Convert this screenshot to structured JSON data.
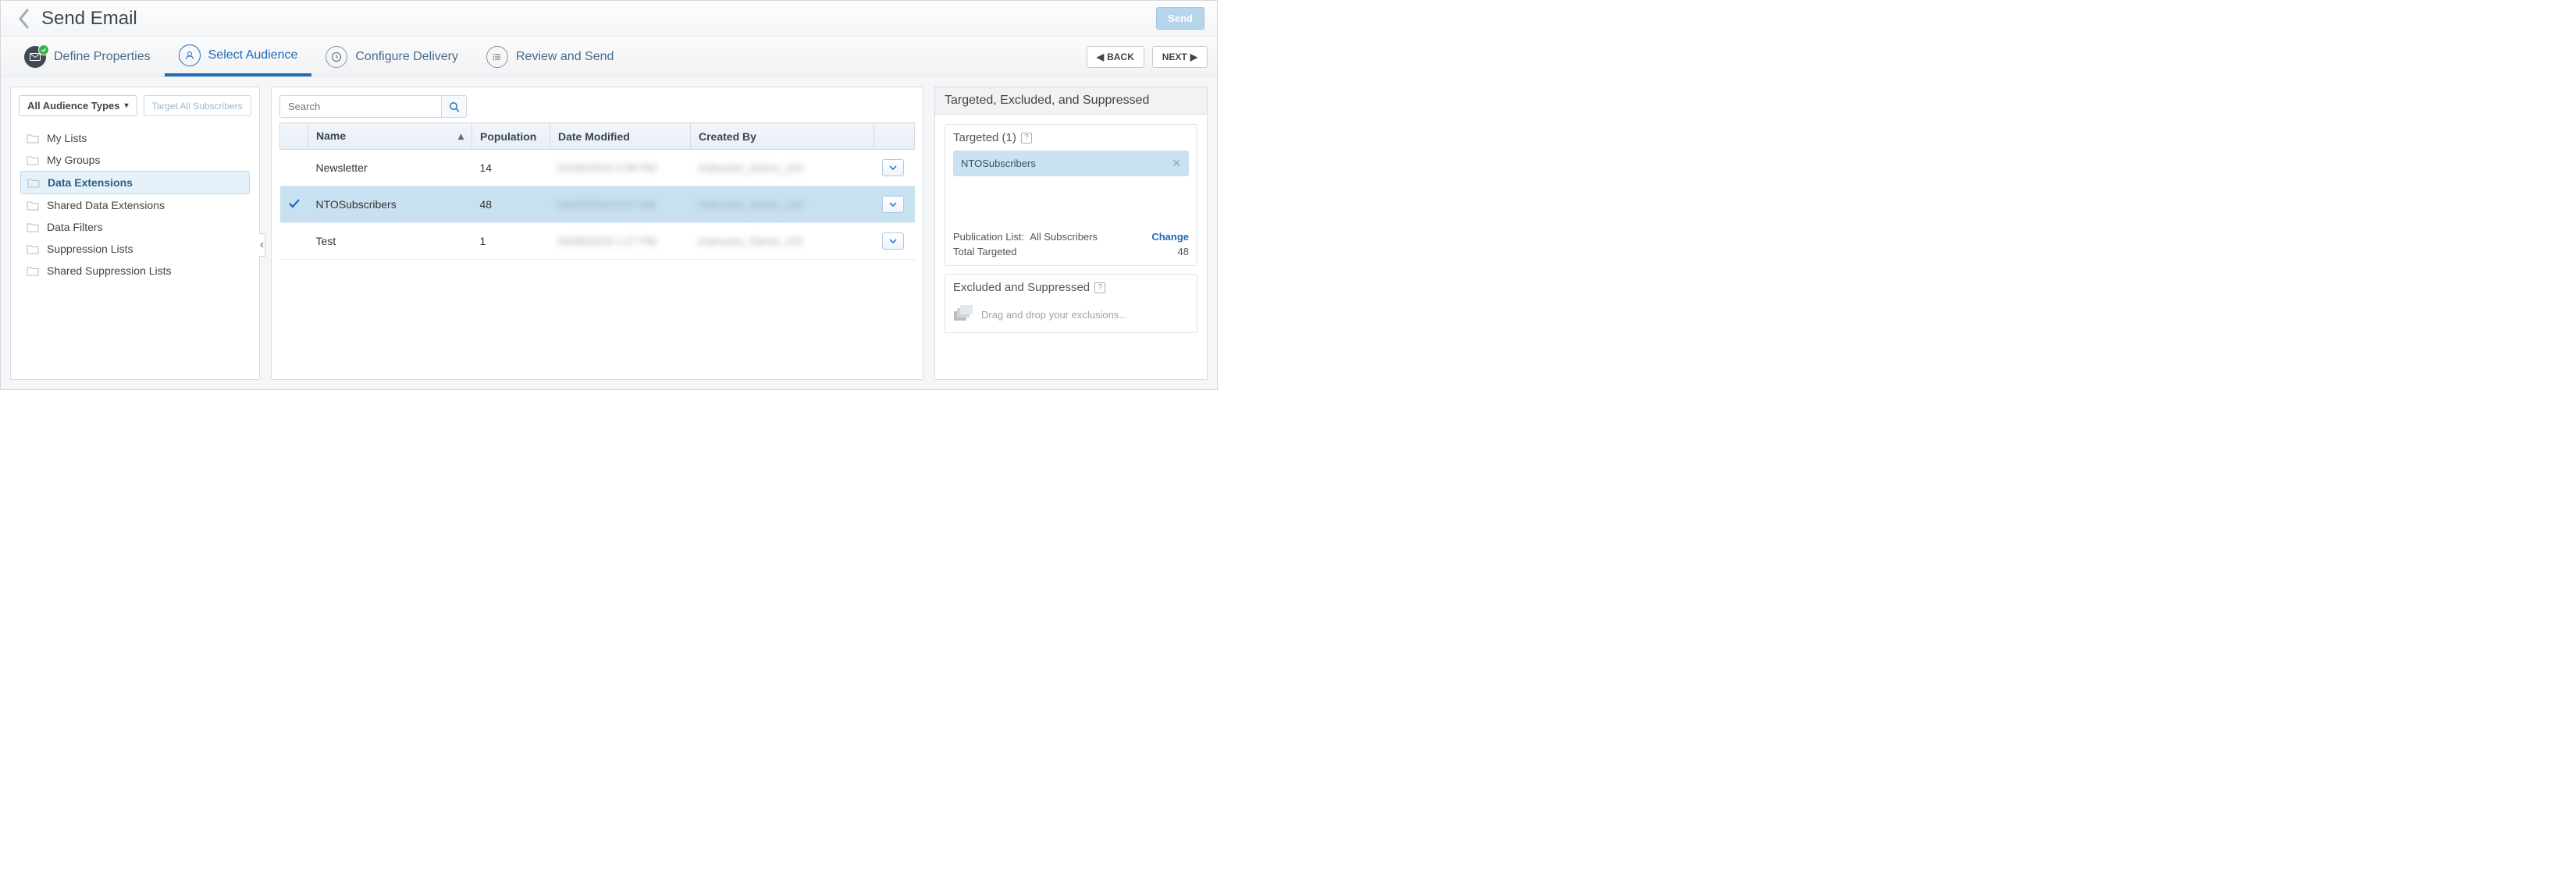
{
  "header": {
    "title": "Send Email",
    "send_label": "Send"
  },
  "wizard": {
    "steps": [
      {
        "label": "Define Properties",
        "icon": "envelope"
      },
      {
        "label": "Select Audience",
        "icon": "user"
      },
      {
        "label": "Configure Delivery",
        "icon": "clock"
      },
      {
        "label": "Review and Send",
        "icon": "list"
      }
    ],
    "back_label": "BACK",
    "next_label": "NEXT"
  },
  "sidebar": {
    "dropdown_label": "All Audience Types",
    "target_all_label": "Target All Subscribers",
    "items": [
      {
        "label": "My Lists"
      },
      {
        "label": "My Groups"
      },
      {
        "label": "Data Extensions"
      },
      {
        "label": "Shared Data Extensions"
      },
      {
        "label": "Data Filters"
      },
      {
        "label": "Suppression Lists"
      },
      {
        "label": "Shared Suppression Lists"
      }
    ]
  },
  "table": {
    "search_placeholder": "Search",
    "columns": {
      "name": "Name",
      "population": "Population",
      "date_modified": "Date Modified",
      "created_by": "Created By"
    },
    "rows": [
      {
        "name": "Newsletter",
        "population": "14",
        "date_mod": "02/26/2019 3:06 PM",
        "created_by": "Instructor_Demo_119",
        "selected": false
      },
      {
        "name": "NTOSubscribers",
        "population": "48",
        "date_mod": "04/15/2019 8:47 AM",
        "created_by": "Instructor_Demo_119",
        "selected": true
      },
      {
        "name": "Test",
        "population": "1",
        "date_mod": "04/09/2019 1:27 PM",
        "created_by": "Instructor_Demo_119",
        "selected": false
      }
    ]
  },
  "right": {
    "header": "Targeted, Excluded, and Suppressed",
    "targeted_label": "Targeted (1)",
    "targeted_chip": "NTOSubscribers",
    "pub_list_label": "Publication List:",
    "pub_list_value": "All Subscribers",
    "change_label": "Change",
    "total_targeted_label": "Total Targeted",
    "total_targeted_value": "48",
    "excluded_label": "Excluded and Suppressed",
    "excluded_hint": "Drag and drop your exclusions..."
  }
}
